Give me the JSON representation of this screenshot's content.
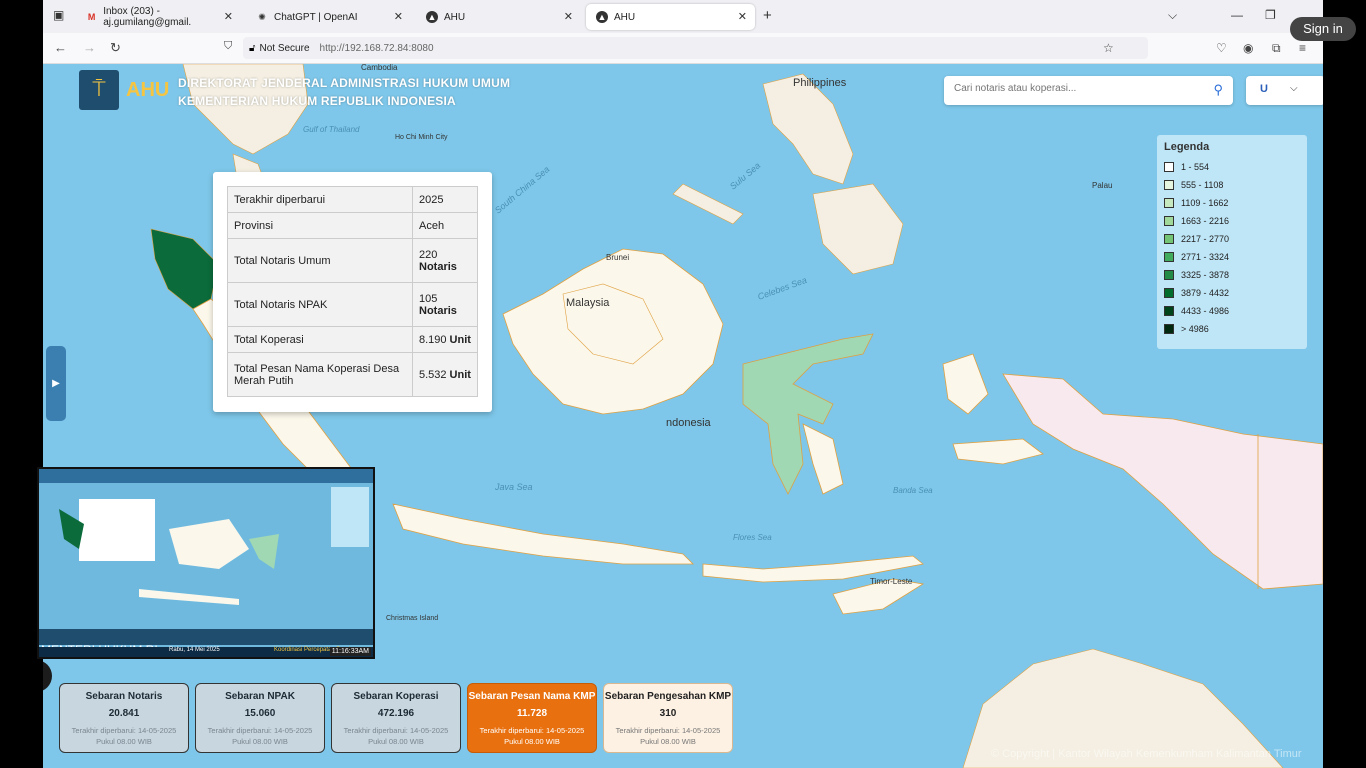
{
  "browser": {
    "tabs": [
      {
        "label": "Inbox (203) - aj.gumilang@gmail.",
        "icon": "gmail-icon"
      },
      {
        "label": "ChatGPT | OpenAI",
        "icon": "openai-icon"
      },
      {
        "label": "AHU",
        "icon": "ahu-icon"
      },
      {
        "label": "AHU",
        "icon": "ahu-icon",
        "active": true
      }
    ],
    "not_secure": "Not Secure",
    "url": "http://192.168.72.84:8080",
    "sign_in": "Sign in"
  },
  "header": {
    "line1": "DIREKTORAT JENDERAL ADMINISTRASI HUKUM UMUM",
    "line2": "KEMENTERIAN HUKUM REPUBLIK INDONESIA",
    "search_placeholder": "Cari notaris atau koperasi...",
    "user_initial": "U"
  },
  "legend": {
    "title": "Legenda",
    "items": [
      {
        "label": "1 - 554",
        "color": "#ffffff"
      },
      {
        "label": "555 - 1108",
        "color": "#e5f5e0"
      },
      {
        "label": "1109 - 1662",
        "color": "#c7e9c0"
      },
      {
        "label": "1663 - 2216",
        "color": "#a1d99b"
      },
      {
        "label": "2217 - 2770",
        "color": "#74c476"
      },
      {
        "label": "2771 - 3324",
        "color": "#41ab5d"
      },
      {
        "label": "3325 - 3878",
        "color": "#238b45"
      },
      {
        "label": "3879 - 4432",
        "color": "#006d2c"
      },
      {
        "label": "4433 - 4986",
        "color": "#00441b"
      },
      {
        "label": "> 4986",
        "color": "#002910"
      }
    ]
  },
  "map_labels": {
    "philippines": "Philippines",
    "malaysia": "Malaysia",
    "indonesia": "ndonesia",
    "brunei": "Brunei",
    "timor_leste": "Timor-Leste",
    "palau": "Palau",
    "christmas_island": "Christmas\nIsland",
    "java_sea": "Java Sea",
    "celebes_sea": "Celebes Sea",
    "sulu_sea": "Sulu Sea",
    "south_china_sea": "South China Sea",
    "banda_sea": "Banda Sea",
    "flores_sea": "Flores Sea",
    "gulf_thailand": "Gulf of\nThailand",
    "cambodia": "Cambodia",
    "ho_chi_minh": "Ho Chi Minh City"
  },
  "popup": {
    "rows": [
      {
        "key": "Terakhir diperbarui",
        "value": "2025",
        "unit": ""
      },
      {
        "key": "Provinsi",
        "value": "Aceh",
        "unit": ""
      },
      {
        "key": "Total Notaris Umum",
        "value": "220",
        "unit": "Notaris"
      },
      {
        "key": "Total Notaris NPAK",
        "value": "105",
        "unit": "Notaris"
      },
      {
        "key": "Total Koperasi",
        "value": "8.190",
        "unit": "Unit"
      },
      {
        "key": "Total Pesan Nama Koperasi Desa Merah Putih",
        "value": "5.532",
        "unit": "Unit"
      }
    ]
  },
  "pip": {
    "caption": "MENTERI HUKUM RI",
    "date": "Rabu, 14 Mei 2025",
    "ticker": "Koordinasi Percepatan Pembe",
    "time": "11:16:33AM"
  },
  "cards": [
    {
      "title": "Sebaran Notaris",
      "value": "20.841",
      "updated": "Terakhir diperbarui: 14-05-2025",
      "time": "Pukul 08.00 WIB",
      "style": "gray"
    },
    {
      "title": "Sebaran NPAK",
      "value": "15.060",
      "updated": "Terakhir diperbarui: 14-05-2025",
      "time": "Pukul 08.00 WIB",
      "style": "gray"
    },
    {
      "title": "Sebaran Koperasi",
      "value": "472.196",
      "updated": "Terakhir diperbarui: 14-05-2025",
      "time": "Pukul 08.00 WIB",
      "style": "gray"
    },
    {
      "title": "Sebaran Pesan Nama KMP",
      "value": "11.728",
      "updated": "Terakhir diperbarui: 14-05-2025",
      "time": "Pukul 08.00 WIB",
      "style": "orange"
    },
    {
      "title": "Sebaran Pengesahan KMP",
      "value": "310",
      "updated": "Terakhir diperbarui: 14-05-2025",
      "time": "Pukul 08.00 WIB",
      "style": "cream"
    }
  ],
  "copyright": "© Copyright | Kantor Wilayah Kemenkumham Kalimantan Timur"
}
